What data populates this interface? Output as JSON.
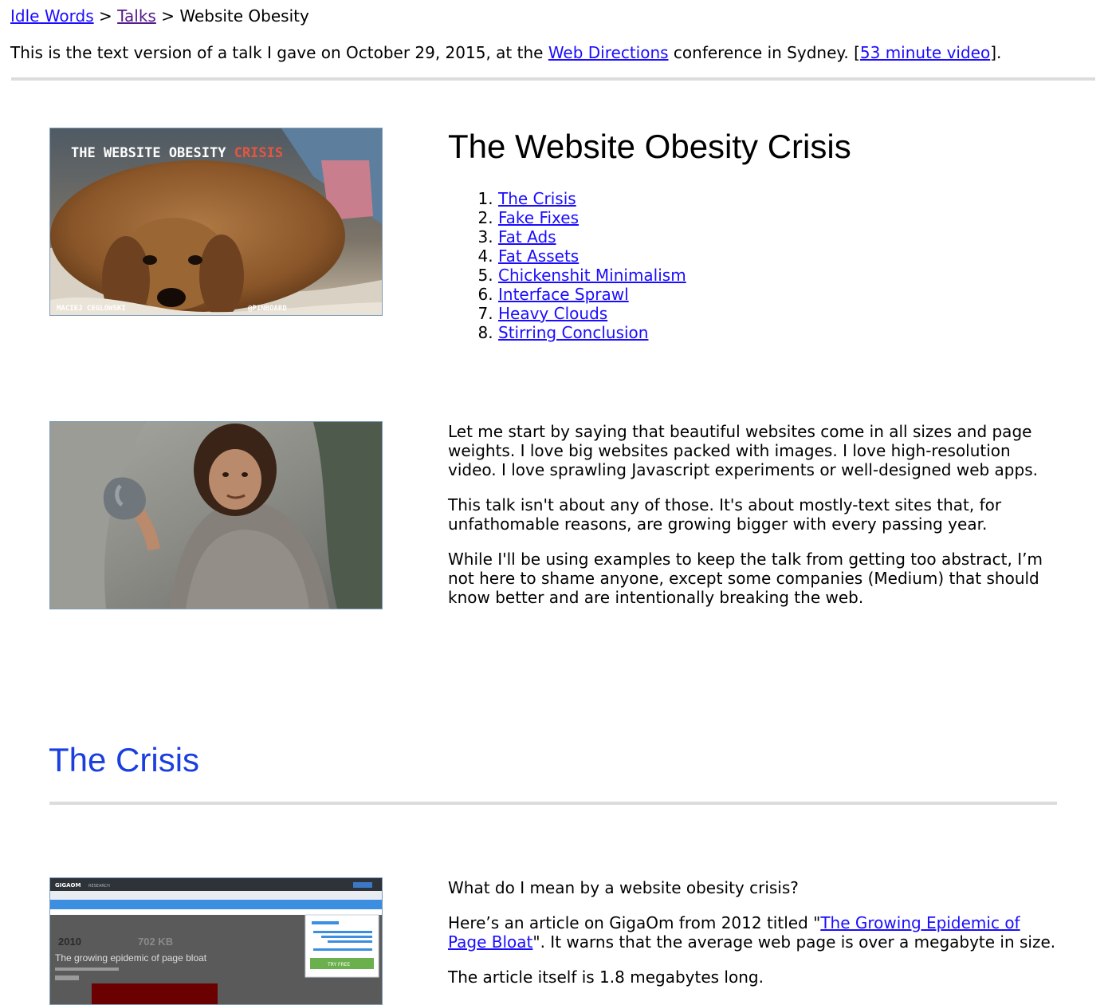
{
  "breadcrumb": {
    "home": "Idle Words",
    "sep1": " > ",
    "talks": "Talks",
    "sep2": " > ",
    "current": "Website Obesity"
  },
  "intro": {
    "before": "This is the text version of a talk I gave on October 29, 2015, at the ",
    "link": "Web Directions",
    "middle": " conference in Sydney. [",
    "video_link": "53 minute video",
    "after": "]."
  },
  "title": "The Website Obesity Crisis",
  "toc": [
    "The Crisis",
    "Fake Fixes",
    "Fat Ads",
    "Fat Assets",
    "Chickenshit Minimalism",
    "Interface Sprawl",
    "Heavy Clouds",
    "Stirring Conclusion"
  ],
  "slide1": {
    "title_white": "THE WEBSITE OBESITY ",
    "title_red": "CRISIS",
    "author": "MACIEJ CEGLOWSKI",
    "handle": "@PINBOARD"
  },
  "slide3": {
    "brand": "GIGAOM",
    "section": "RESEARCH",
    "year": "2010",
    "size": "702 KB",
    "headline": "The growing epidemic of page bloat",
    "button": "TRY FREE"
  },
  "intro_paragraphs": [
    "Let me start by saying that beautiful websites come in all sizes and page weights. I love big websites packed with images. I love high-resolution video. I love sprawling Javascript experiments or well-designed web apps.",
    "This talk isn't about any of those. It's about mostly-text sites that, for unfathomable reasons, are growing bigger with every passing year.",
    "While I'll be using examples to keep the talk from getting too abstract, I’m not here to shame anyone, except some companies (Medium) that should know better and are intentionally breaking the web."
  ],
  "section_crisis": {
    "heading": "The Crisis",
    "p1": "What do I mean by a website obesity crisis?",
    "p2_before": "Here’s an article on GigaOm from 2012 titled \"",
    "p2_link": "The Growing Epidemic of Page Bloat",
    "p2_after": "\". It warns that the average web page is over a megabyte in size.",
    "p3": "The article itself is 1.8 megabytes long."
  },
  "colors": {
    "link": "#1a0dff",
    "visited": "#551a8b",
    "section_heading": "#1a3fe0",
    "rule": "#dcdcdc",
    "slide_border": "#7f9db9"
  }
}
